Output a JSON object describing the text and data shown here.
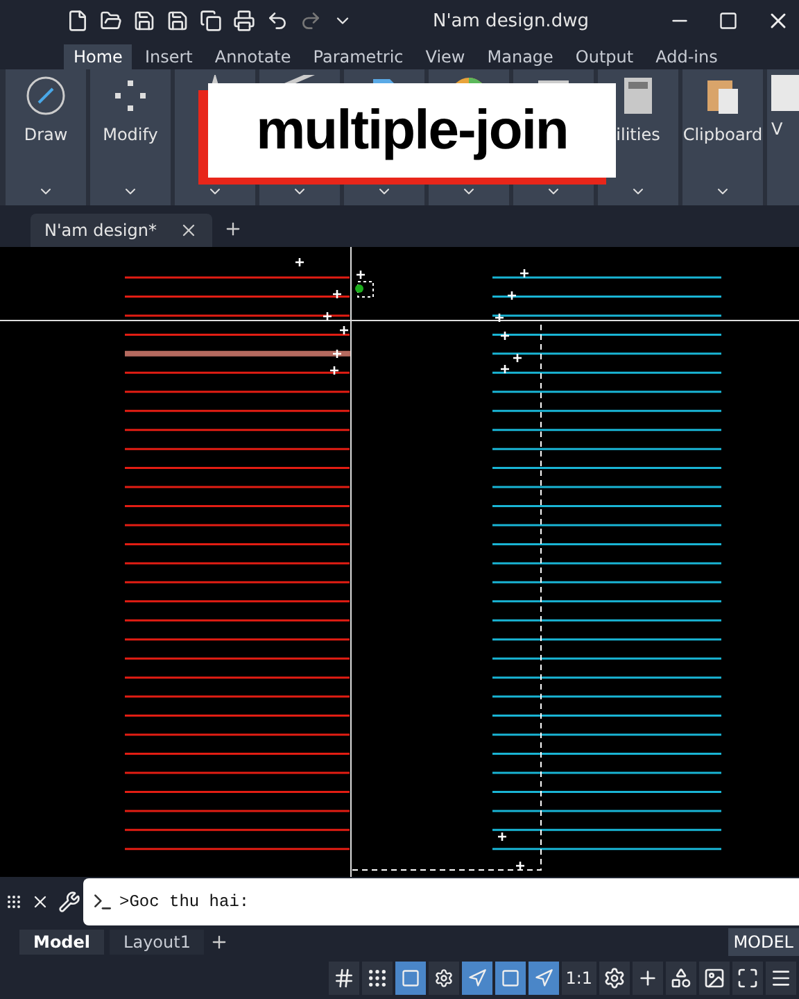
{
  "window": {
    "title": "N'am design.dwg"
  },
  "ribbon_tabs": [
    {
      "label": "Home",
      "selected": true
    },
    {
      "label": "Insert",
      "selected": false
    },
    {
      "label": "Annotate",
      "selected": false
    },
    {
      "label": "Parametric",
      "selected": false
    },
    {
      "label": "View",
      "selected": false
    },
    {
      "label": "Manage",
      "selected": false
    },
    {
      "label": "Output",
      "selected": false
    },
    {
      "label": "Add-ins",
      "selected": false
    }
  ],
  "ribbon_panels": [
    {
      "kind": "circle",
      "label": "Draw"
    },
    {
      "kind": "dots",
      "label": "Modify"
    },
    {
      "kind": "text"
    },
    {
      "kind": "pen"
    },
    {
      "kind": "doc"
    },
    {
      "kind": "pie"
    },
    {
      "kind": "frame"
    },
    {
      "kind": "calc",
      "label": "ilities"
    },
    {
      "kind": "clipboard",
      "label": "Clipboard"
    },
    {
      "kind": "blank",
      "label": "V"
    }
  ],
  "overlay_caption": "multiple-join",
  "document_tabs": [
    {
      "label": "N'am design*",
      "selected": true
    }
  ],
  "command_line": {
    "value": ">Goc thu hai:"
  },
  "layout_tabs": [
    {
      "label": "Model",
      "selected": true
    },
    {
      "label": "Layout1",
      "selected": false
    }
  ],
  "status_bar": {
    "space": "MODEL",
    "scale": "1:1"
  }
}
